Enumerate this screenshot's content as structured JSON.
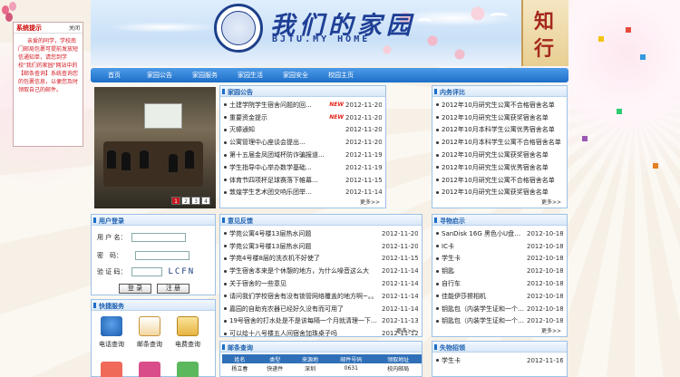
{
  "notice": {
    "title": "系统提示",
    "close": "关闭",
    "body": "亲爱的同学，学校南门邮局包裹可提前发放短信通知单，请您到学校\"我们的家园\"网站中的【邮条查询】系统查询您的包裹信息，以便您及时领取自己的邮件。"
  },
  "banner": {
    "title_cn": "我们的家园",
    "title_en": "BJTU.MY HOME",
    "scroll_chars": [
      "知",
      "行"
    ]
  },
  "nav": [
    "首页",
    "家园公告",
    "家园服务",
    "家园生活",
    "家园安全",
    "校园主页"
  ],
  "slideshow": {
    "pages": [
      "1",
      "2",
      "3",
      "4"
    ],
    "active": 0
  },
  "announce": {
    "title": "家园公告",
    "more": "更多>>",
    "new_badge": "NEW",
    "items": [
      {
        "text": "土建学院学生宿舍问题的回...",
        "date": "2012-11-20",
        "new": true
      },
      {
        "text": "重要资金提示",
        "date": "2012-11-20",
        "new": true
      },
      {
        "text": "灭蟑通知",
        "date": "2012-11-20",
        "new": false
      },
      {
        "text": "公寓管理中心座谈会提出...",
        "date": "2012-11-20",
        "new": false
      },
      {
        "text": "第十五届金凤团域杯防诈骗报道...",
        "date": "2012-11-19",
        "new": false
      },
      {
        "text": "学生指导中心举办数学基础...",
        "date": "2012-11-19",
        "new": false
      },
      {
        "text": "体育节四项杯足球赛落下帷幕...",
        "date": "2012-11-15",
        "new": false
      },
      {
        "text": "敦煌学生艺术团交响乐团举...",
        "date": "2012-11-14",
        "new": false
      }
    ]
  },
  "review": {
    "title": "内务评比",
    "more": "更多>>",
    "items": [
      "2012年10月研究生公寓不合格宿舍名单",
      "2012年10月研究生公寓获奖宿舍名单",
      "2012年10月本科学生公寓优秀宿舍名单",
      "2012年10月本科学生公寓不合格宿舍名单",
      "2012年10月研究生公寓获奖宿舍名单",
      "2012年10月研究生公寓优秀宿舍名单",
      "2012年10月研究生公寓不合格宿舍名单",
      "2012年10月研究生公寓获奖宿舍名单"
    ]
  },
  "login": {
    "title": "用户登录",
    "user_label": "用 户 名：",
    "pass_label": "密　码：",
    "captcha_label": "验 证 码：",
    "captcha": "LCFN",
    "login_btn": "登 录",
    "register_btn": "注 册"
  },
  "feedback": {
    "title": "意见反馈",
    "more": "更多>>",
    "items": [
      {
        "text": "学苑公寓4号楼13层热水问题",
        "date": "2012-11-20"
      },
      {
        "text": "学苑公寓3号楼13层热水问题",
        "date": "2012-11-20"
      },
      {
        "text": "学苑4号楼8层的洗衣机不好使了",
        "date": "2012-11-15"
      },
      {
        "text": "学生宿舍本来是个休憩的地方，为什么噪音这么大",
        "date": "2012-11-14"
      },
      {
        "text": "关于宿舍的一些意见",
        "date": "2012-11-14"
      },
      {
        "text": "请问我们学校宿舍有没有锁管网络覆盖的地方啊~。。",
        "date": "2012-11-14"
      },
      {
        "text": "嘉园的自助充农器已经好久没有而可用了",
        "date": "2012-11-14"
      },
      {
        "text": "19号宿舍的打水处是不是该每隔一个月就清理一下内...",
        "date": "2012-11-13"
      },
      {
        "text": "可以给十八号楼五人间宿舍加珠桌子吗",
        "date": "2012-11-12"
      }
    ]
  },
  "lost": {
    "title": "寻物启示",
    "more": "更多>>",
    "items": [
      {
        "text": "SanDisk 16G 黑色小U盘，有贺...",
        "date": "2012-10-18"
      },
      {
        "text": "IC卡",
        "date": "2012-10-18"
      },
      {
        "text": "学生卡",
        "date": "2012-10-18"
      },
      {
        "text": "钥匙",
        "date": "2012-10-18"
      },
      {
        "text": "自行车",
        "date": "2012-10-18"
      },
      {
        "text": "佳能伊莎擦相机",
        "date": "2012-10-18"
      },
      {
        "text": "钥匙包（内装学生证和一个U盘）",
        "date": "2012-10-18"
      },
      {
        "text": "钥匙包（内装学生证和一个U盘）",
        "date": "2012-10-18"
      }
    ]
  },
  "quick": {
    "title": "快捷服务",
    "items": [
      "电话查询",
      "邮条查询",
      "电费查询"
    ]
  },
  "mail": {
    "title": "邮条查询",
    "headers": [
      "姓名",
      "类型",
      "来源地",
      "邮件号码",
      "领取地址"
    ],
    "row": [
      "杨立春",
      "快递件",
      "深圳",
      "0631",
      "校内邮局"
    ]
  },
  "found": {
    "title": "失物招领",
    "items": [
      {
        "text": "学生卡",
        "date": "2012-11-16"
      }
    ]
  },
  "colors": {
    "nav": "#1c6ec8",
    "head_text": "#1c5fb0",
    "notice_text": "#d2161f",
    "new": "#e2231a"
  }
}
